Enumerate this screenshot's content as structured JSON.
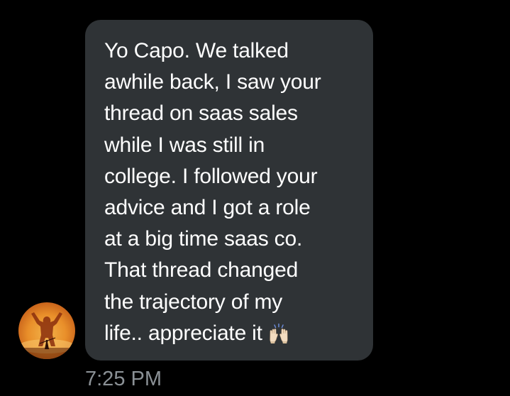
{
  "conversation": {
    "message": {
      "lines": [
        "Yo Capo. We talked",
        "awhile back, I saw your",
        "thread on saas sales",
        "while I was still in",
        "college. I followed your",
        "advice and I got a role",
        "at a big time saas co.",
        "That thread changed",
        "the trajectory of my",
        "life.. appreciate it"
      ],
      "emoji": "raising-hands-icon",
      "timestamp": "7:25 PM"
    }
  },
  "colors": {
    "background": "#000000",
    "bubble": "#2f3336",
    "text": "#ffffff",
    "timestamp": "#8b9196"
  }
}
